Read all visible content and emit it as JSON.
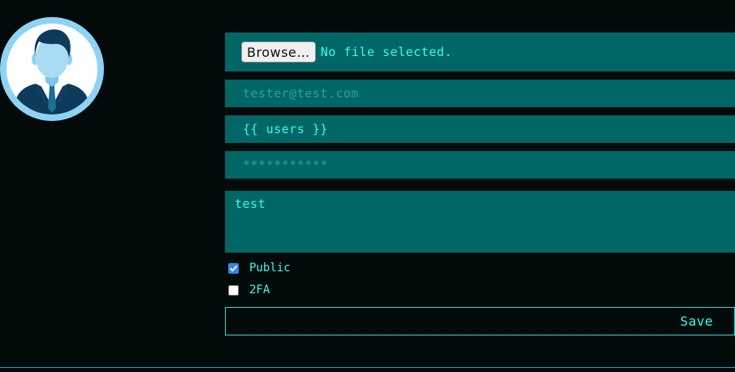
{
  "avatar": {
    "icon": "user-avatar-icon",
    "ring_color": "#8fd3f4",
    "suit_color": "#0d3b5c"
  },
  "form": {
    "file": {
      "button_label": "Browse…",
      "status": "No file selected."
    },
    "email": {
      "placeholder": "tester@test.com",
      "value": ""
    },
    "username": {
      "value": "{{ users }}"
    },
    "password": {
      "placeholder": "***********",
      "value": ""
    },
    "bio": {
      "value": "test"
    },
    "public": {
      "label": "Public",
      "checked": true
    },
    "two_factor": {
      "label": "2FA",
      "checked": false
    },
    "save_label": "Save"
  },
  "colors": {
    "background": "#020a0a",
    "field_bg": "#006666",
    "accent_text": "#33ffee",
    "placeholder_text": "#2aa39a",
    "checkbox_checked": "#3b82e6"
  }
}
